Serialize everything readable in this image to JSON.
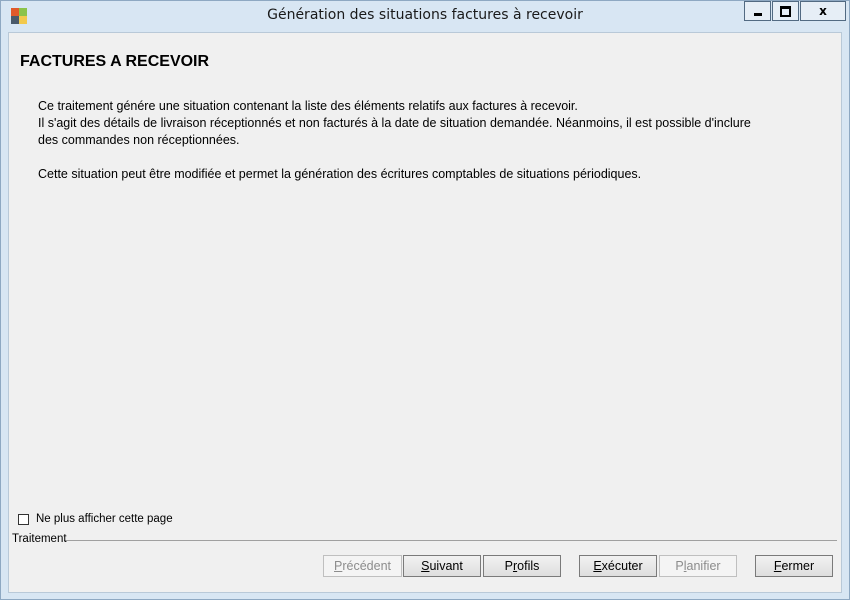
{
  "window": {
    "title": "Génération des situations factures à recevoir",
    "controls": {
      "minimize": "minimize",
      "maximize": "maximize",
      "close": "x"
    }
  },
  "content": {
    "heading": "FACTURES A RECEVOIR",
    "paragraph1": [
      "Ce traitement génére une situation contenant la liste des éléments relatifs aux factures à recevoir.",
      "Il s'agit des détails de livraison réceptionnés et non facturés à la date de situation demandée. Néanmoins, il est possible d'inclure",
      "des commandes non réceptionnées."
    ],
    "paragraph2": "Cette situation peut être modifiée et permet la génération des écritures comptables de situations périodiques."
  },
  "checkbox": {
    "label": "Ne plus afficher cette page",
    "checked": false
  },
  "group": {
    "label": "Traitement"
  },
  "buttons": [
    {
      "key": "precedent",
      "label": "Précédent",
      "mnemonic": "P",
      "enabled": false
    },
    {
      "key": "suivant",
      "label": "Suivant",
      "mnemonic": "S",
      "enabled": true
    },
    {
      "key": "profils",
      "label": "Profils",
      "mnemonic": "r",
      "enabled": true
    },
    {
      "key": "executer",
      "label": "Exécuter",
      "mnemonic": "E",
      "enabled": true
    },
    {
      "key": "planifier",
      "label": "Planifier",
      "mnemonic": "l",
      "enabled": false
    },
    {
      "key": "fermer",
      "label": "Fermer",
      "mnemonic": "F",
      "enabled": true
    }
  ],
  "icons": {
    "app": "app-icon",
    "minimize": "minimize-icon",
    "maximize": "maximize-icon",
    "close": "close-icon"
  }
}
